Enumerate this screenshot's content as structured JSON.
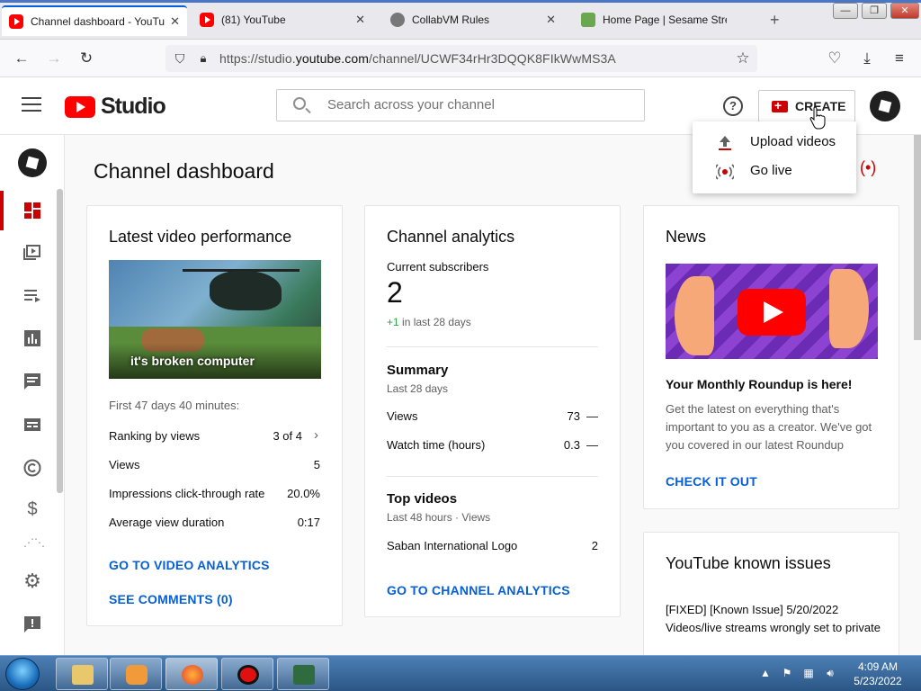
{
  "browser": {
    "tabs": [
      {
        "label": "Channel dashboard - YouTube Studio",
        "active": true
      },
      {
        "label": "(81) YouTube",
        "active": false
      },
      {
        "label": "CollabVM Rules",
        "active": false
      },
      {
        "label": "Home Page | Sesame Street",
        "active": false
      }
    ],
    "new_tab": "+",
    "window_buttons": {
      "minimize": "—",
      "restore": "❐",
      "close": "✕"
    },
    "url_prefix": "https://studio.",
    "url_domain": "youtube.com",
    "url_path": "/channel/UCWF34rHr3DQQK8FIkWwMS3A"
  },
  "header": {
    "logo_text": "Studio",
    "search_placeholder": "Search across your channel",
    "help": "?",
    "create_label": "CREATE"
  },
  "create_menu": {
    "items": [
      {
        "label": "Upload videos",
        "icon": "upload-icon"
      },
      {
        "label": "Go live",
        "icon": "live-icon"
      }
    ]
  },
  "page": {
    "title": "Channel dashboard"
  },
  "latest_video": {
    "title": "Latest video performance",
    "thumbnail_caption": "it's broken computer",
    "period": "First 47 days 40 minutes:",
    "rows": [
      {
        "label": "Ranking by views",
        "value": "3 of 4"
      },
      {
        "label": "Views",
        "value": "5"
      },
      {
        "label": "Impressions click-through rate",
        "value": "20.0%"
      },
      {
        "label": "Average view duration",
        "value": "0:17"
      }
    ],
    "link_analytics": "GO TO VIDEO ANALYTICS",
    "link_comments": "SEE COMMENTS (0)"
  },
  "channel_analytics": {
    "title": "Channel analytics",
    "subscribers_label": "Current subscribers",
    "subscribers_value": "2",
    "subscribers_delta": "+1",
    "subscribers_delta_period": "in last 28 days",
    "summary_title": "Summary",
    "summary_period": "Last 28 days",
    "summary_rows": [
      {
        "label": "Views",
        "value": "73",
        "trend": "—"
      },
      {
        "label": "Watch time (hours)",
        "value": "0.3",
        "trend": "—"
      }
    ],
    "top_videos_title": "Top videos",
    "top_videos_period": "Last 48 hours · Views",
    "top_videos": [
      {
        "label": "Saban International Logo",
        "value": "2"
      }
    ],
    "link": "GO TO CHANNEL ANALYTICS"
  },
  "news": {
    "title": "News",
    "headline": "Your Monthly Roundup is here!",
    "body": "Get the latest on everything that's important to you as a creator. We've got you covered in our latest Roundup",
    "link": "CHECK IT OUT"
  },
  "known_issues": {
    "title": "YouTube known issues",
    "body": "[FIXED] [Known Issue] 5/20/2022 Videos/live streams wrongly set to private"
  },
  "taskbar": {
    "time": "4:09 AM",
    "date": "5/23/2022"
  },
  "colors": {
    "youtube_red": "#ff0000",
    "link_blue": "#065fd4",
    "positive_green": "#2ba640"
  }
}
